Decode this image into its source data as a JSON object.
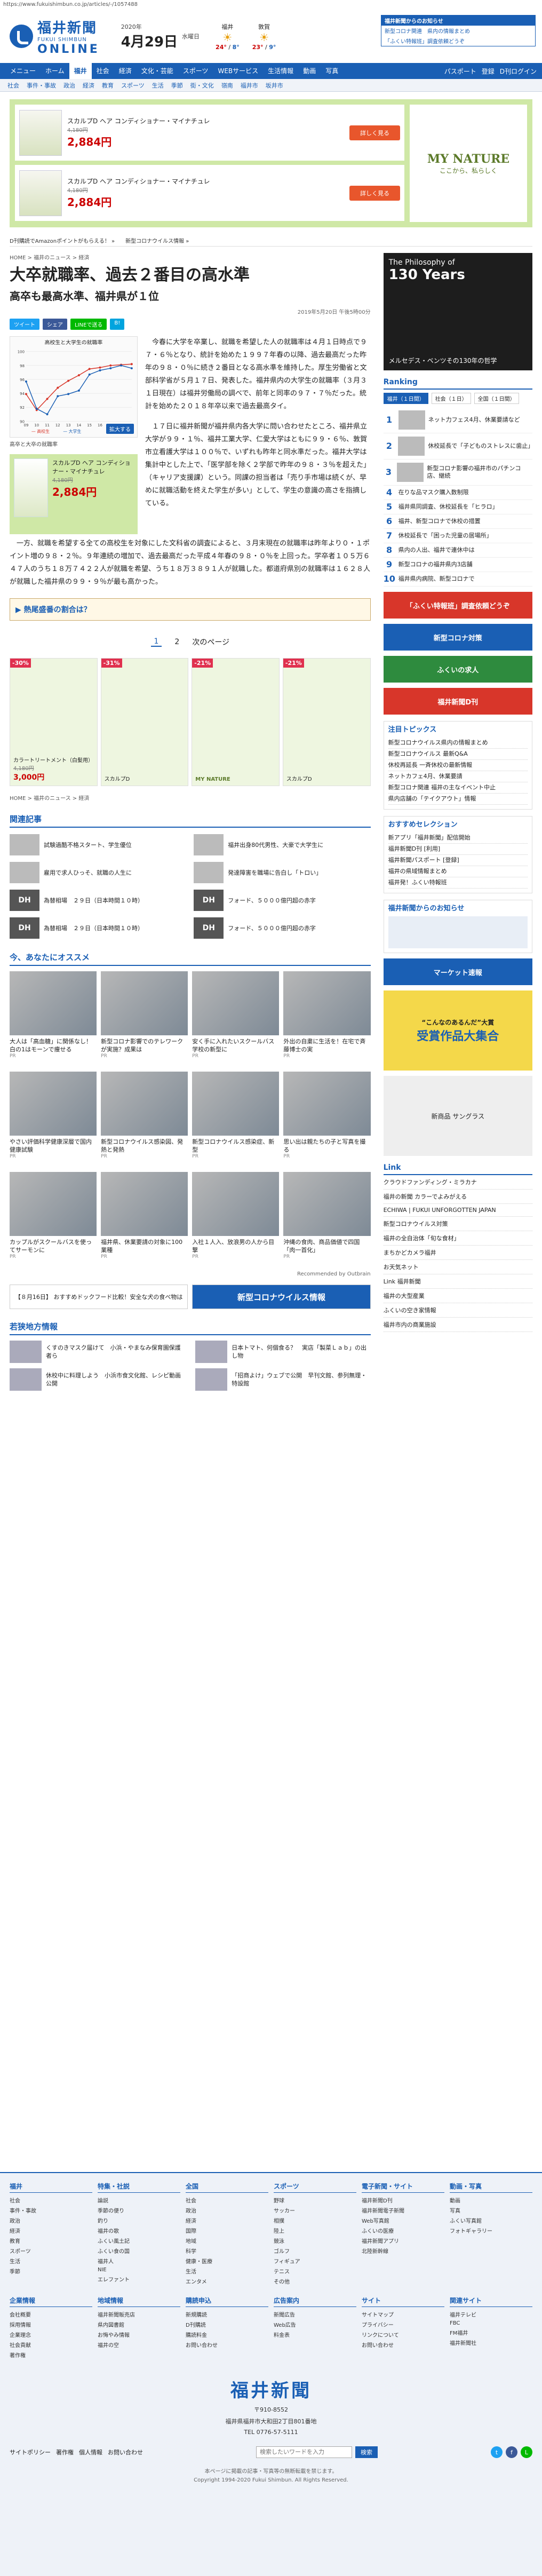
{
  "url": "https://www.fukuishimbun.co.jp/articles/-/1057488",
  "header": {
    "logo_ja": "福井新聞",
    "logo_sub": "FUKUI SHIMBUN",
    "logo_online": "ONLINE",
    "year": "2020年",
    "month_day": "4月29日",
    "weekday": "水曜日",
    "weather": [
      {
        "area": "福井",
        "icon": "sun-icon",
        "temp": "24°",
        "temp2": "8°"
      },
      {
        "area": "敦賀",
        "icon": "sun-icon",
        "temp": "23°",
        "temp2": "9°"
      }
    ],
    "notice_title": "福井新聞からのお知らせ",
    "notices": [
      "新型コロナ関連　県内の情報まとめ",
      "「ふくい特報班」調査依頼どうぞ"
    ]
  },
  "nav": {
    "items": [
      "メニュー",
      "ホーム",
      "福井",
      "社会",
      "経済",
      "文化・芸能",
      "スポーツ",
      "WEBサービス",
      "生活情報",
      "動画",
      "写真"
    ],
    "active_index": 2,
    "right": [
      "パスポート",
      "登録",
      "D刊ログイン"
    ]
  },
  "subnav": [
    "社会",
    "事件・事故",
    "政治",
    "経済",
    "教育",
    "スポーツ",
    "生活",
    "季節",
    "街・文化",
    "嶺南",
    "福井市",
    "坂井市"
  ],
  "top_ad": {
    "rows": [
      {
        "name": "スカルプD ヘア コンディショナー・マイナチュレ",
        "old_price": "4,180円",
        "price": "2,884円",
        "button": "詳しく見る"
      },
      {
        "name": "スカルプD ヘア コンディショナー・マイナチュレ",
        "old_price": "4,180円",
        "price": "2,884円",
        "button": "詳しく見る"
      }
    ],
    "brand": "MY NATURE",
    "brand_sub": "ここから、私らしく"
  },
  "ticker": [
    "D刊購読でAmazonポイントがもらえる！ »",
    "新型コロナウイルス情報 »"
  ],
  "breadcrumb": [
    "HOME",
    "福井のニュース",
    "経済"
  ],
  "article": {
    "headline": "大卒就職率、過去２番目の高水準",
    "subhead": "高卒も最高水準、福井県が１位",
    "date": "2019年5月20日 午後5時00分",
    "share": [
      "ツイート",
      "シェア",
      "LINEで送る",
      "B!"
    ],
    "figure_caption": "高卒と大卒の就職率",
    "zoom": "拡大する",
    "chart_title": "高校生と大学生の就職率",
    "paragraphs": [
      "今春に大学を卒業し、就職を希望した人の就職率は４月１日時点で９７・６％となり、統計を始めた１９９７年春の以降、過去最高だった昨年の９８・０％に続き２番目となる高水準を維持した。厚生労働省と文部科学省が５月１７日、発表した。福井県内の大学生の就職率（３月３１日現在）は福井労働局の調べで、前年と同率の９７・７％だった。統計を始めた２０１８年卒以来で過去最高タイ。",
      "１７日に福井新聞が福井県内各大学に問い合わせたところ、福井県立大学が９９・１％、福井工業大学、仁愛大学はともに９９・６％、敦賀市立看護大学は１００％で、いずれも昨年と同水準だった。福井大学は集計中とした上で、「医学部を除く２学部で昨年の９８・３％を超えた」（キャリア支援課）という。同課の担当者は「売り手市場は続くが、早めに就職活動を終えた学生が多い」として、学生の意識の高さを指摘している。"
    ],
    "full_paragraph": "一方、就職を希望する全ての高校生を対象にした文科省の調査によると、３月末現在の就職率は昨年より０・１ポイント増の９８・２％。９年連続の増加で、過去最高だった平成４年春の９８・０％を上回った。学卒者１０５万６４７人のうち１８万７４２２人が就職を希望、うち１８万３８９１人が就職した。都道府県別の就職率は１６２８人が就職した福井県の９９・９％が最も高かった。",
    "related_box": "熱尾盛番の割合は？",
    "pager": [
      "1",
      "2",
      "次のページ"
    ]
  },
  "grid_ad": [
    {
      "pct": "-30%",
      "name": "カラートリートメント（白髪用）",
      "old": "4,180円",
      "price": "3,000円"
    },
    {
      "pct": "-31%",
      "name": "スカルプD",
      "old": "",
      "price": ""
    },
    {
      "pct": "-21%",
      "name": "MY NATURE",
      "old": "",
      "price": ""
    },
    {
      "pct": "-21%",
      "name": "スカルプD",
      "old": "",
      "price": ""
    }
  ],
  "related": {
    "title": "関連記事",
    "items": [
      {
        "thumb": "",
        "text": "試験過酷不格スタート、学生優位"
      },
      {
        "thumb": "",
        "text": "福井出身80代男性、大豪で大学生に"
      },
      {
        "thumb": "",
        "text": "雇用で求人ひっそ、就職の人生に"
      },
      {
        "thumb": "",
        "text": "発達障害を職場に告白し「トロい」"
      },
      {
        "thumb": "DH",
        "text": "為替相場　２９日（日本時間１０時）"
      },
      {
        "thumb": "DH",
        "text": "フォード、５０００億円超の赤字"
      },
      {
        "thumb": "DH",
        "text": "為替相場　２９日（日本時間１０時）"
      },
      {
        "thumb": "DH",
        "text": "フォード、５０００億円超の赤字"
      }
    ]
  },
  "recommend": {
    "title": "今、あなたにオススメ",
    "items": [
      {
        "text": "大人は「高血糖」に関係なし！白の1はモーンで痩せる",
        "src": "PR"
      },
      {
        "text": "新型コロナ影響でのテレワークが実施？成果は",
        "src": "PR"
      },
      {
        "text": "安く手に入れたいスクールバス学校の新型に",
        "src": "PR"
      },
      {
        "text": "外出の自粛に生活を！在宅で斉藤博士の実",
        "src": "PR"
      },
      {
        "text": "やさい評価科学健康深層で国内健康試験",
        "src": "PR"
      },
      {
        "text": "新型コロナウイルス感染図、発熱と発熱",
        "src": "PR"
      },
      {
        "text": "新型コロナウイルス感染症、新型",
        "src": "PR"
      },
      {
        "text": "思い出は親たちの子と写真を撮る",
        "src": "PR"
      },
      {
        "text": "カップルがスクールバスを使ってサーモンに",
        "src": "PR"
      },
      {
        "text": "福井県、休業要請の対象に100業種",
        "src": "PR"
      },
      {
        "text": "入社１人入、放浪男の人から目撃",
        "src": "PR"
      },
      {
        "text": "沖縄の食肉、商品価値で四国「肉一首化」",
        "src": "PR"
      }
    ],
    "outbrain": "Recommended by Outbrain"
  },
  "bottom_banners": [
    "【８月16日】 おすすめドックフード比較！安全な犬の食べ物は",
    "新型コロナウイルス情報"
  ],
  "latest": {
    "title": "若狭地方情報",
    "items": [
      {
        "text": "くすのきマスク届けて　小浜・やまなみ保育園保護者ら"
      },
      {
        "text": "日本トマト、何個食る？　実店「製菜Ｌａｂ」の出し物"
      },
      {
        "text": "休校中に料理しよう　小浜市食文化館、レシピ動画公開"
      },
      {
        "text": "「招商よけ」ウェブで公開　早刊文館、参列無理・特設館"
      }
    ]
  },
  "side": {
    "ad_line1": "The Philosophy of",
    "ad_line2": "130 Years",
    "ad_line3": "メルセデス・ベンツその130年の哲学",
    "ranking_title": "Ranking",
    "ranking_tabs": [
      "福井（１日間）",
      "社会（１日）",
      "全国（１日間）"
    ],
    "ranking": [
      {
        "num": "1",
        "text": "ネット力フェス4月、休業要請など"
      },
      {
        "num": "2",
        "text": "休校延長で「子どものストレスに歯止」"
      },
      {
        "num": "3",
        "text": "新型コロナ影響の福井市のパチンコ店、継続"
      },
      {
        "num": "4",
        "text": "在りな品マスク購入数制限"
      },
      {
        "num": "5",
        "text": "福井県同調査、休校延長を「ヒラロ」"
      },
      {
        "num": "6",
        "text": "福井、新型コロナで休校の措置"
      },
      {
        "num": "7",
        "text": "休校延長で「困った児童の居場所」"
      },
      {
        "num": "8",
        "text": "県内の人出、福井で連休中は"
      },
      {
        "num": "9",
        "text": "新型コロナの福井県内3店舗"
      },
      {
        "num": "10",
        "text": "福井県内病院、新型コロナで"
      }
    ],
    "notice_title": "「ふくい特報班」調査依頼どうぞ",
    "banners": [
      "新型コロナ対策",
      "ふくいの求人",
      "福井新聞D刊"
    ],
    "topics_title": "注目トピックス",
    "topics": [
      "新型コロナウイルス県内の情報まとめ",
      "新型コロナウイルス 最新Q&A",
      "休校再延長 一斉休校の最新情報",
      "ネットカフェ4月、休業要請",
      "新型コロナ関連 福井の主なイベント中止",
      "県内店舗の「テイクアウト」情報"
    ],
    "reco_title": "おすすめセレクション",
    "reco": [
      "新アプリ「福井新聞」配信開始",
      "福井新聞D刊 [利用]",
      "福井新聞パスポート [登録]",
      "福井の県域情報まとめ",
      "福井発！ふくい特報班"
    ],
    "sns_title": "福井新聞からのお知らせ",
    "market": "マーケット速報",
    "yellow_big": "受賞作品大集合",
    "yellow_small": "“こんなのあるんだ”大賞",
    "sunglass": "新商品 サングラス",
    "links_title": "Link",
    "links": [
      "クラウドファンディング・ミラカナ",
      "福井の新聞 カラーでよみがえる",
      "ECHIWA | FUKUI UNFORGOTTEN JAPAN",
      "新型コロナウイルス対策",
      "福井の全自治体「旬な食材」",
      "まちかどカメラ福井",
      "お天気ネット",
      "Link 福井新聞",
      "福井の大型産業",
      "ふくいの空き家情報",
      "福井市内の商業施設"
    ]
  },
  "footer": {
    "cols": [
      {
        "title": "福井",
        "items": [
          "社会",
          "事件・事故",
          "政治",
          "経済",
          "教育",
          "スポーツ",
          "生活",
          "季節"
        ]
      },
      {
        "title": "特集・社説",
        "items": [
          "論説",
          "季節の便り",
          "釣り",
          "福井の歌",
          "ふくい風土記",
          "ふくい食の国",
          "福井人",
          "NIE",
          "エレファント"
        ]
      },
      {
        "title": "全国",
        "items": [
          "社会",
          "政治",
          "経済",
          "国際",
          "地域",
          "科学",
          "健康・医療",
          "生活",
          "エンタメ"
        ]
      },
      {
        "title": "スポーツ",
        "items": [
          "野球",
          "サッカー",
          "相撲",
          "陸上",
          "競泳",
          "ゴルフ",
          "フィギュア",
          "テニス",
          "その他"
        ]
      },
      {
        "title": "電子新聞・サイト",
        "items": [
          "福井新聞D刊",
          "福井新聞電子新聞",
          "Web写真館",
          "ふくいの医療",
          "福井新聞アプリ",
          "北陸新幹線"
        ]
      },
      {
        "title": "動画・写真",
        "items": [
          "動画",
          "写真",
          "ふくい写真館",
          "フォトギャラリー"
        ]
      }
    ],
    "cols2": [
      {
        "title": "企業情報",
        "items": [
          "会社概要",
          "採用情報",
          "企業理念",
          "社会貢献",
          "著作権"
        ]
      },
      {
        "title": "地域情報",
        "items": [
          "福井新聞販売店",
          "県内図書館",
          "お悔やみ情報",
          "福井の空"
        ]
      },
      {
        "title": "購読申込",
        "items": [
          "新規購読",
          "D刊購読",
          "購読料金",
          "お問い合わせ"
        ]
      },
      {
        "title": "広告案内",
        "items": [
          "新聞広告",
          "Web広告",
          "料金表"
        ]
      },
      {
        "title": "サイト",
        "items": [
          "サイトマップ",
          "プライバシー",
          "リンクについて",
          "お問い合わせ"
        ]
      },
      {
        "title": "関連サイト",
        "items": [
          "福井テレビ",
          "FBC",
          "FM福井",
          "福井新聞社"
        ]
      }
    ],
    "logo": "福井新聞",
    "zip": "〒910-8552",
    "address": "福井県福井市大和田2丁目801番地",
    "tel": "TEL 0776-57-5111",
    "links": [
      "サイトポリシー",
      "著作権",
      "個人情報",
      "お問い合わせ"
    ],
    "search_placeholder": "検索したいワードを入力",
    "search_button": "検索",
    "copy1": "本ページに掲載の記事・写真等の無断転載を禁じます。",
    "copy2": "Copyright 1994-2020 Fukui Shimbun. All Rights Reserved."
  },
  "chart_data": {
    "type": "line",
    "title": "高校生と大学生の就職率",
    "x": [
      "09",
      "10",
      "11",
      "12",
      "13",
      "14",
      "15",
      "16",
      "17",
      "18",
      "19"
    ],
    "series": [
      {
        "name": "高校生",
        "values": [
          93.9,
          91.6,
          93.2,
          94.8,
          95.8,
          96.6,
          97.5,
          97.7,
          98.0,
          98.1,
          98.2
        ]
      },
      {
        "name": "大学生",
        "values": [
          95.7,
          91.8,
          91.0,
          93.6,
          93.9,
          94.4,
          96.7,
          97.3,
          97.6,
          98.0,
          97.6
        ]
      }
    ],
    "ylim": [
      90,
      100
    ],
    "xlabel": "",
    "ylabel": ""
  }
}
